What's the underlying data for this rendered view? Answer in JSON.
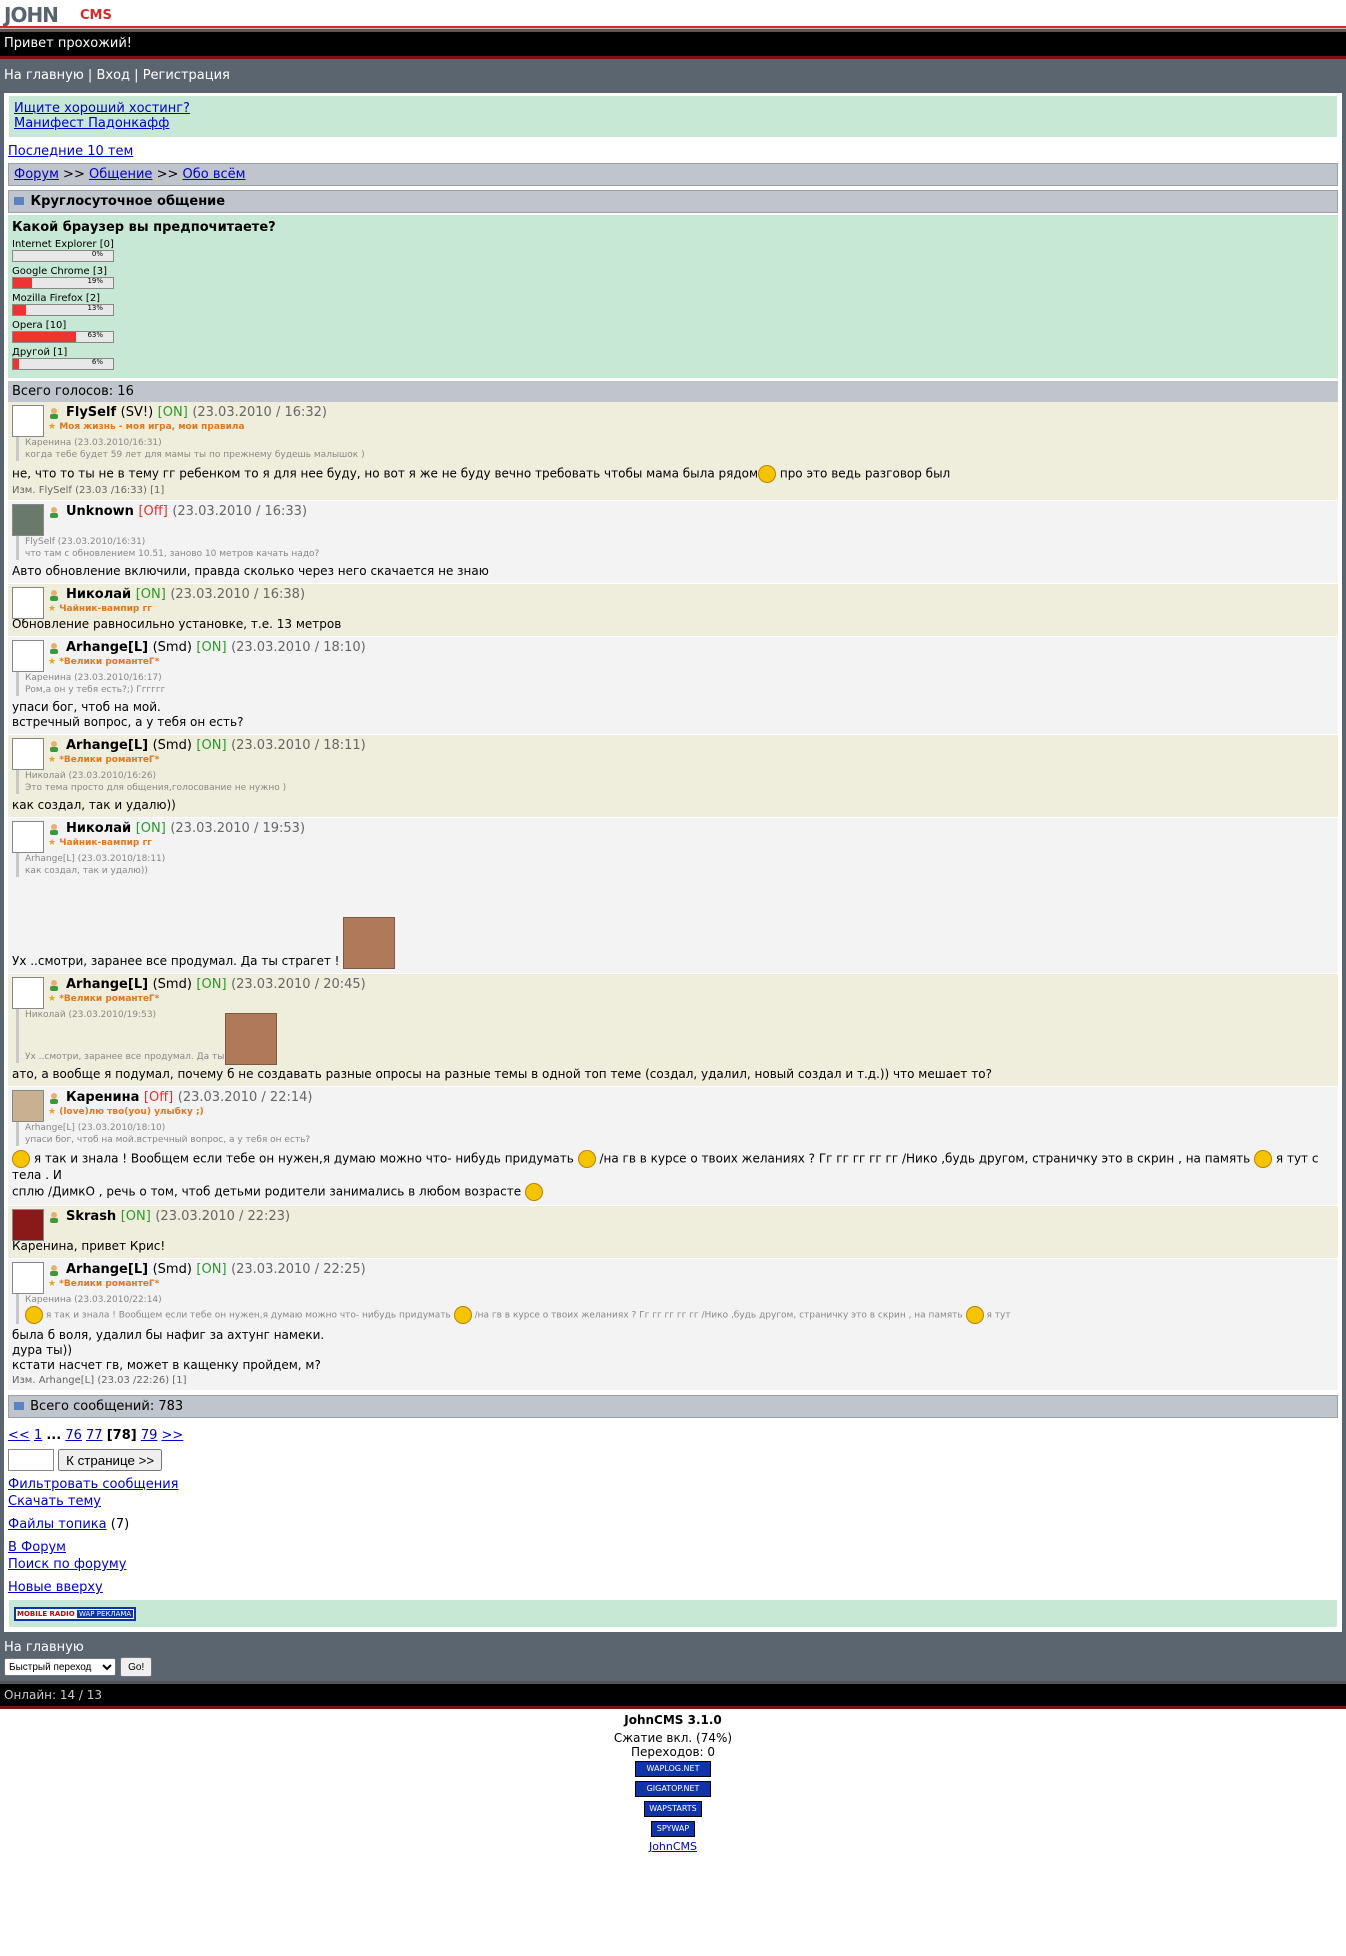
{
  "logo": {
    "part1": "JOHN",
    "part2": "CMS"
  },
  "greeting": "Привет прохожий!",
  "topnav": {
    "home": "На главную",
    "login": "Вход",
    "register": "Регистрация",
    "sep": "|"
  },
  "ads": [
    "Ищите хороший хостинг?",
    "Манифест Падонкафф"
  ],
  "last_topics": "Последние 10 тем",
  "breadcrumb": {
    "forum": "Форум",
    "sep": ">>",
    "general": "Общение",
    "section": "Обо всём"
  },
  "topic_title": "Круглосуточное общение",
  "poll": {
    "question": "Какой браузер вы предпочитаете?",
    "options": [
      {
        "label": "Internet Explorer [0]",
        "percent": 0,
        "pct_text": "0%"
      },
      {
        "label": "Google Chrome [3]",
        "percent": 19,
        "pct_text": "19%"
      },
      {
        "label": "Mozilla Firefox [2]",
        "percent": 13,
        "pct_text": "13%"
      },
      {
        "label": "Opera [10]",
        "percent": 63,
        "pct_text": "63%"
      },
      {
        "label": "Другой [1]",
        "percent": 6,
        "pct_text": "6%"
      }
    ],
    "total": "Всего голосов: 16"
  },
  "posts": [
    {
      "name": "FlySelf",
      "rank": "(SV!)",
      "status": "[ON]",
      "time": "(23.03.2010 / 16:32)",
      "sub": "Моя жизнь - моя игра, мои правила",
      "quote_head": "Каренина (23.03.2010/16:31)",
      "quote_body": "когда тебе будет 59 лет для мамы ты по прежнему будешь малышок )",
      "text": "не, что то ты не в тему гг ребенком то я для нее буду, но вот я же не буду вечно требовать чтобы мама была рядом",
      "text2": "про это ведь разговор был",
      "edit": "Изм. FlySelf (23.03 /16:33) [1]"
    },
    {
      "name": "Unknown",
      "status": "[Off]",
      "time": "(23.03.2010 / 16:33)",
      "quote_head": "FlySelf (23.03.2010/16:31)",
      "quote_body": "что там с обновлением 10.51, заново 10 метров качать надо?",
      "text": "Авто обновление включили, правда сколько через него скачается не знаю"
    },
    {
      "name": "Николай",
      "status": "[ON]",
      "time": "(23.03.2010 / 16:38)",
      "sub": "Чайник-вампир гг",
      "text": "Обновление равносильно установке, т.е. 13 метров"
    },
    {
      "name": "Arhange[L]",
      "rank": "(Smd)",
      "status": "[ON]",
      "time": "(23.03.2010 / 18:10)",
      "sub": "*Велики романтеГ*",
      "quote_head": "Каренина (23.03.2010/16:17)",
      "quote_body": "Ром,а он у тебя есть?;) Гггггг",
      "text": "упаси бог, чтоб на мой.",
      "text2": "встречный вопрос, а у тебя он есть?"
    },
    {
      "name": "Arhange[L]",
      "rank": "(Smd)",
      "status": "[ON]",
      "time": "(23.03.2010 / 18:11)",
      "sub": "*Велики романтеГ*",
      "quote_head": "Николай (23.03.2010/16:26)",
      "quote_body": "Это тема просто для общения,голосование не нужно )",
      "text": "как создал, так и удалю))"
    },
    {
      "name": "Николай",
      "status": "[ON]",
      "time": "(23.03.2010 / 19:53)",
      "sub": "Чайник-вампир гг",
      "quote_head": "Arhange[L] (23.03.2010/18:11)",
      "quote_body": "как создал, так и удалю))",
      "text": "Ух ..смотри, заранее все продумал. Да ты страгет !"
    },
    {
      "name": "Arhange[L]",
      "rank": "(Smd)",
      "status": "[ON]",
      "time": "(23.03.2010 / 20:45)",
      "sub": "*Велики романтеГ*",
      "quote_head": "Николай (23.03.2010/19:53)",
      "quote_body": "Ух ..смотри, заранее все продумал. Да ты страгет !",
      "text": "ато, а вообще я подумал, почему б не создавать разные опросы на разные темы в одной топ теме (создал, удалил, новый создал и т.д.)) что мешает то?"
    },
    {
      "name": "Каренина",
      "status": "[Off]",
      "time": "(23.03.2010 / 22:14)",
      "sub": "(love)лю тво(you) улыбку ;)",
      "quote_head": "Arhange[L] (23.03.2010/18:10)",
      "quote_body": "упаси бог, чтоб на мой.встречный вопрос, а у тебя он есть?",
      "text": "я так и знала ! Вообщем если тебе он нужен,я думаю можно что- нибудь придумать",
      "text2": "/на гв в курсе о твоих желаниях ? Гг гг гг гг гг /Нико ,будь другом, страничку это в скрин , на память",
      "text3": "я тут с тела . И",
      "text4": "сплю /ДимкО , речь о том, чтоб детьми родители занимались в любом возрасте"
    },
    {
      "name": "Skrash",
      "status": "[ON]",
      "time": "(23.03.2010 / 22:23)",
      "text": "Каренина, привет Крис!"
    },
    {
      "name": "Arhange[L]",
      "rank": "(Smd)",
      "status": "[ON]",
      "time": "(23.03.2010 / 22:25)",
      "sub": "*Велики романтеГ*",
      "quote_head": "Каренина (23.03.2010/22:14)",
      "quote_body": "я так и знала ! Вообщем если тебе он нужен,я думаю можно что- нибудь придумать",
      "quote_body2": "/на гв в курсе о твоих желаниях ? Гг гг гг гг гг /Нико ,будь другом, страничку это в скрин , на память",
      "quote_body3": "я тут",
      "text": "была б воля, удалил бы нафиг за ахтунг намеки.",
      "text2": "дура ты))",
      "text3": "кстати насчет гв, может в кащенку пройдем, м?",
      "edit": "Изм. Arhange[L] (23.03 /22:26) [1]"
    }
  ],
  "total_messages": "Всего сообщений: 783",
  "pager": {
    "prev": "<<",
    "p1": "1",
    "dots": "...",
    "p76": "76",
    "p77": "77",
    "current": "[78]",
    "p79": "79",
    "next": ">>",
    "button": "К странице >>"
  },
  "links": {
    "filter": "Фильтровать сообщения",
    "download": "Скачать тему",
    "files": "Файлы топика",
    "files_count": "(7)",
    "to_forum": "В Форум",
    "search": "Поиск по форуму",
    "new_top": "Новые вверху"
  },
  "banner": {
    "a": "MOBILE RADIO",
    "b": "WAP РЕКЛАМА"
  },
  "footer": {
    "home": "На главную",
    "quick": "Быстрый переход",
    "go": "Go!",
    "online": "Онлайн: 14 / 13"
  },
  "bottom": {
    "version": "JohnCMS 3.1.0",
    "compress": "Сжатие вкл. (74%)",
    "transitions": "Переходов: 0",
    "counters": [
      "WAPLOG.NET",
      "GIGATOP.NET",
      "WAPSTARTS",
      "SPYWAP"
    ],
    "link": "JohnCMS"
  },
  "colors": {
    "accent": "#5b6570",
    "green": "#c7e8d4",
    "odd": "#efeddb",
    "even": "#f3f3f3",
    "on": "#2a9a2a",
    "off": "#e03030",
    "rank": "#e07820"
  }
}
